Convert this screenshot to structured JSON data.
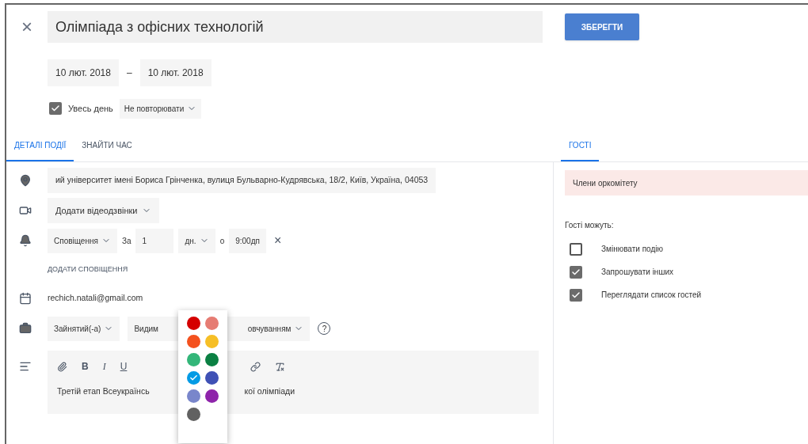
{
  "header": {
    "close": "×",
    "title": "Олімпіада з офісних технологій",
    "save_button": "ЗБЕРЕГТИ"
  },
  "dates": {
    "start": "10 лют. 2018",
    "separator": "–",
    "end": "10 лют. 2018"
  },
  "all_day": {
    "label": "Увесь день",
    "checked": true
  },
  "repeat": "Не повторювати",
  "tabs": [
    {
      "label": "ДЕТАЛІ ПОДІЇ",
      "selected": true
    },
    {
      "label": "ЗНАЙТИ ЧАС",
      "selected": false
    }
  ],
  "guests_tab": {
    "label": "ГОСТІ",
    "selected": true
  },
  "location": "ий університет імені Бориса Грінченка, вулиця Бульварно-Кудрявська, 18/2, Київ, Україна, 04053",
  "video": "Додати відеодзвінки",
  "notification": {
    "type": "Сповіщення",
    "prefix": "За",
    "amount": "1",
    "unit": "дн.",
    "at": "о",
    "time": "9:00дп",
    "remove": "×"
  },
  "add_notification": "ДОДАТИ СПОВІЩЕННЯ",
  "calendar": "rechich.natali@gmail.com",
  "busy": "Зайнятий(-а)",
  "visibility": {
    "left": "Видим",
    "right": "овчуванням"
  },
  "help": "?",
  "toolbar": {
    "bold": "B",
    "italic": "I",
    "underline": "U"
  },
  "description": {
    "left": "Третій етап Всеукраїнсь",
    "right": "кої олімпіади"
  },
  "palette": [
    {
      "color": "#d50000",
      "selected": false
    },
    {
      "color": "#e67c73",
      "selected": false
    },
    {
      "color": "#f4511e",
      "selected": false
    },
    {
      "color": "#f6bf26",
      "selected": false
    },
    {
      "color": "#33b679",
      "selected": false
    },
    {
      "color": "#0b8043",
      "selected": false
    },
    {
      "color": "#039be5",
      "selected": true
    },
    {
      "color": "#3f51b5",
      "selected": false
    },
    {
      "color": "#7986cb",
      "selected": false
    },
    {
      "color": "#8e24aa",
      "selected": false
    },
    {
      "color": "#616161",
      "selected": false
    }
  ],
  "guests": {
    "chip": "Члени оркомітету",
    "heading": "Гості можуть:",
    "permissions": [
      {
        "label": "Змінювати подію",
        "checked": false
      },
      {
        "label": "Запрошувати інших",
        "checked": true
      },
      {
        "label": "Переглядати список гостей",
        "checked": true
      }
    ]
  }
}
